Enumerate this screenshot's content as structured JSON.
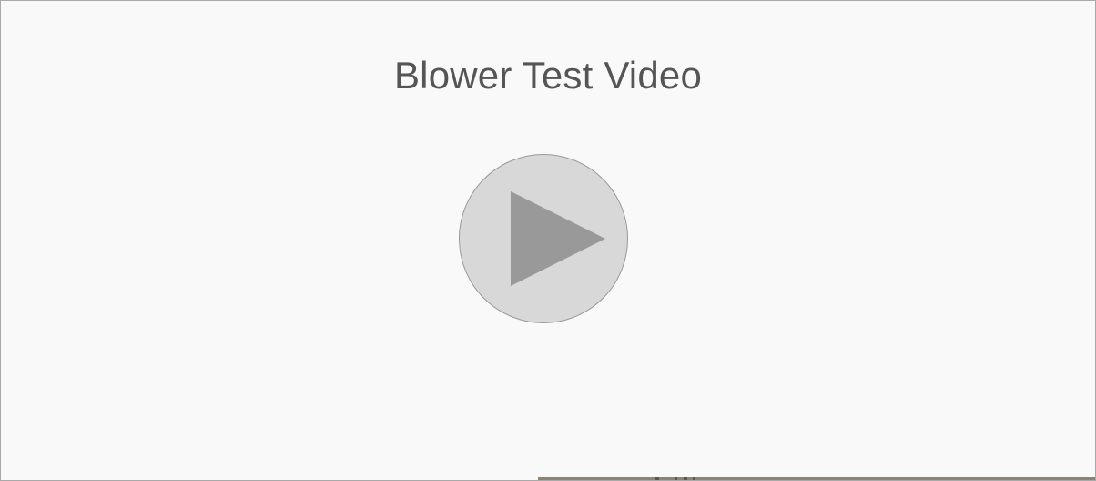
{
  "video": {
    "title": "Blower Test Video",
    "play_icon": "play-icon"
  },
  "colors": {
    "background": "#f9f9f9",
    "border": "#a9a9a9",
    "title_text": "#555555",
    "play_circle": "#d8d8d8",
    "play_triangle": "#999999",
    "thumbnail_strip": "#8c8577"
  }
}
